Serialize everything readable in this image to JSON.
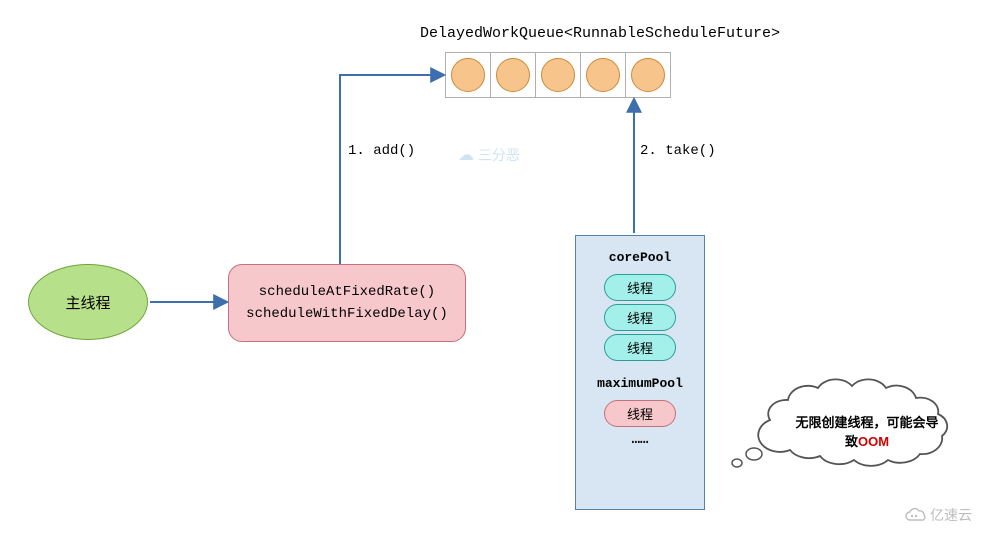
{
  "title": "DelayedWorkQueue<RunnableScheduleFuture>",
  "queue": {
    "cells": 5
  },
  "main_thread": {
    "label": "主线程"
  },
  "schedule_box": {
    "line1": "scheduleAtFixedRate()",
    "line2": "scheduleWithFixedDelay()"
  },
  "edges": {
    "add_label": "1. add()",
    "take_label": "2. take()"
  },
  "pool": {
    "core_label": "corePool",
    "max_label": "maximumPool",
    "core_threads": [
      "线程",
      "线程",
      "线程"
    ],
    "max_threads": [
      "线程"
    ],
    "ellipsis": "……"
  },
  "thought": {
    "text_prefix": "无限创建线程，可能会导致",
    "text_highlight": "OOM"
  },
  "watermarks": {
    "center": "三分恶",
    "corner": "亿速云"
  }
}
